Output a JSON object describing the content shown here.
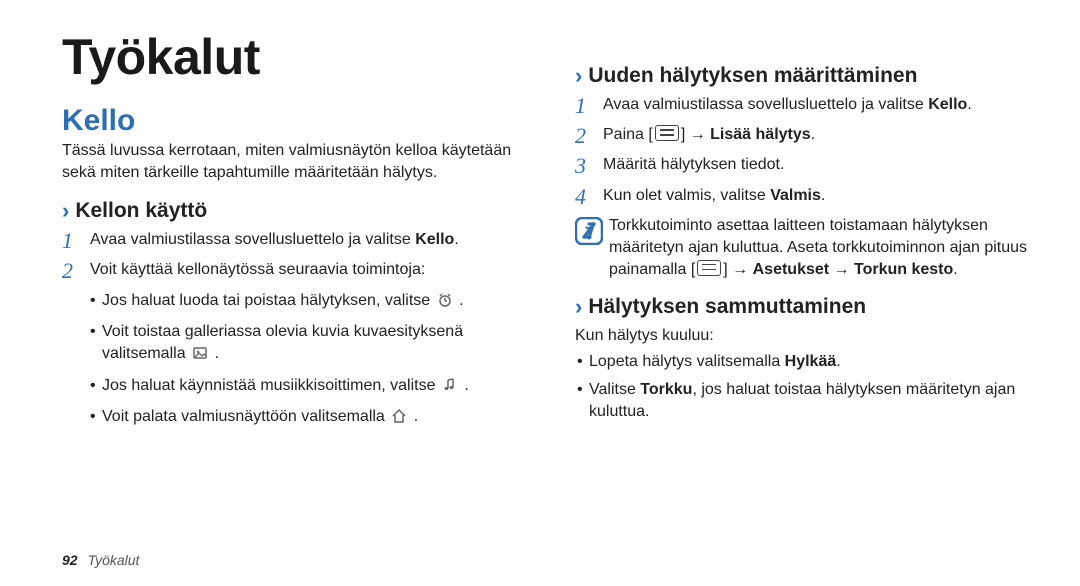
{
  "page_number": "92",
  "footer_label": "Työkalut",
  "title": "Työkalut",
  "left": {
    "section": "Kello",
    "intro": "Tässä luvussa kerrotaan, miten valmiusnäytön kelloa käytetään sekä miten tärkeille tapahtumille määritetään hälytys.",
    "sub1": {
      "heading": "Kellon käyttö",
      "step1_pre": "Avaa valmiustilassa sovellusluettelo ja valitse ",
      "step1_bold": "Kello",
      "step1_post": ".",
      "step2": "Voit käyttää kellonäytössä seuraavia toimintoja:",
      "bullets": {
        "b1": "Jos haluat luoda tai poistaa hälytyksen, valitse ",
        "b1_post": ".",
        "b2": "Voit toistaa galleriassa olevia kuvia kuvaesityksenä valitsemalla ",
        "b2_post": ".",
        "b3": "Jos haluat käynnistää musiikkisoittimen, valitse ",
        "b3_post": ".",
        "b4": "Voit palata valmiusnäyttöön valitsemalla ",
        "b4_post": "."
      }
    }
  },
  "right": {
    "sub2": {
      "heading": "Uuden hälytyksen määrittäminen",
      "step1_pre": "Avaa valmiustilassa sovellusluettelo ja valitse ",
      "step1_bold": "Kello",
      "step1_post": ".",
      "step2_pre": "Paina [",
      "step2_mid": "] → ",
      "step2_bold": "Lisää hälytys",
      "step2_post": ".",
      "step3": "Määritä hälytyksen tiedot.",
      "step4_pre": "Kun olet valmis, valitse ",
      "step4_bold": "Valmis",
      "step4_post": ".",
      "note_pre": "Torkkutoiminto asettaa laitteen toistamaan hälytyksen määritetyn ajan kuluttua. Aseta torkkutoiminnon ajan pituus painamalla [",
      "note_mid": "] → ",
      "note_bold1": "Asetukset",
      "note_arrow": " → ",
      "note_bold2": "Torkun kesto",
      "note_post": "."
    },
    "sub3": {
      "heading": "Hälytyksen sammuttaminen",
      "lead": "Kun hälytys kuuluu:",
      "b1_pre": "Lopeta hälytys valitsemalla ",
      "b1_bold": "Hylkää",
      "b1_post": ".",
      "b2_pre": "Valitse ",
      "b2_bold": "Torkku",
      "b2_post": ", jos haluat toistaa hälytyksen määritetyn ajan kuluttua."
    }
  }
}
